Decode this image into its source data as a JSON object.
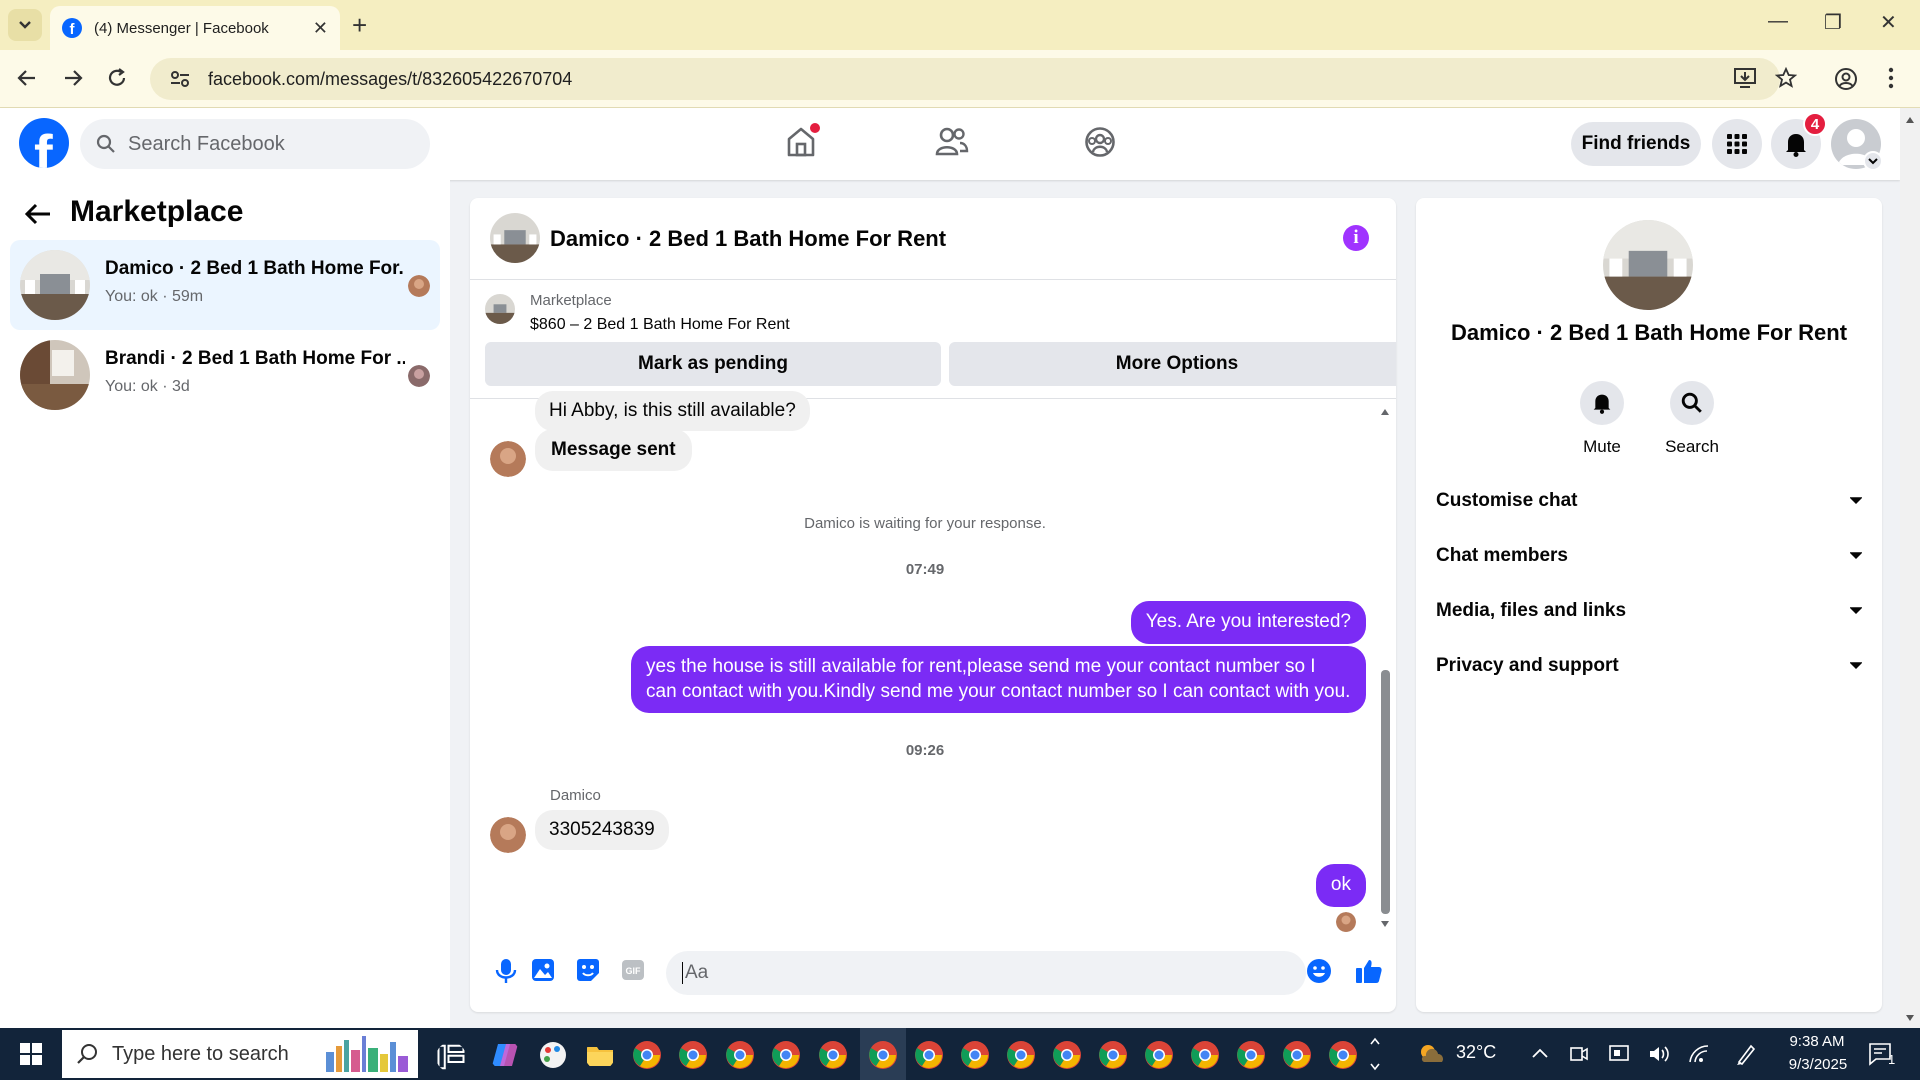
{
  "browser": {
    "tab_title": "(4) Messenger | Facebook",
    "tab_close": "✕",
    "new_tab": "+",
    "url": "facebook.com/messages/t/832605422670704",
    "win_minimize": "—",
    "win_restore": "❐",
    "win_close": "✕"
  },
  "fb_header": {
    "logo": "f",
    "search_placeholder": "Search Facebook",
    "find_friends": "Find friends",
    "notifications_count": "4",
    "accent": "#0866ff"
  },
  "left_panel": {
    "title": "Marketplace",
    "conversations": [
      {
        "name": "Damico · 2 Bed 1 Bath Home For...",
        "sub": "You: ok · 59m",
        "active": true
      },
      {
        "name": "Brandi · 2 Bed 1 Bath Home For ...",
        "sub": "You: ok · 3d",
        "active": false
      }
    ]
  },
  "chat": {
    "title": "Damico · 2 Bed 1 Bath Home For Rent",
    "info_icon": "i",
    "marketplace_label": "Marketplace",
    "listing": "$860 – 2 Bed 1 Bath Home For Rent",
    "mark_pending": "Mark as pending",
    "more_options": "More Options",
    "messages": {
      "m1": "Hi Abby, is this still available?",
      "m2": "Message sent",
      "waiting": "Damico is waiting for your response.",
      "time1": "07:49",
      "m3": "Yes. Are you interested?",
      "m4": "yes the house is still available for rent,please send me your contact number so I can contact with you.Kindly send me your contact number so I can contact with you.",
      "time2": "09:26",
      "sender": "Damico",
      "m5": "3305243839",
      "m6": "ok"
    },
    "composer_placeholder": "Aa",
    "outgoing_color": "#7b2bf5"
  },
  "right_panel": {
    "title": "Damico · 2 Bed 1 Bath Home For Rent",
    "mute": "Mute",
    "search": "Search",
    "sections": [
      "Customise chat",
      "Chat members",
      "Media, files and links",
      "Privacy and support"
    ]
  },
  "taskbar": {
    "search_placeholder": "Type here to search",
    "temperature": "32°C",
    "time": "9:38 AM",
    "date": "9/3/2025",
    "notif_count": "1"
  }
}
